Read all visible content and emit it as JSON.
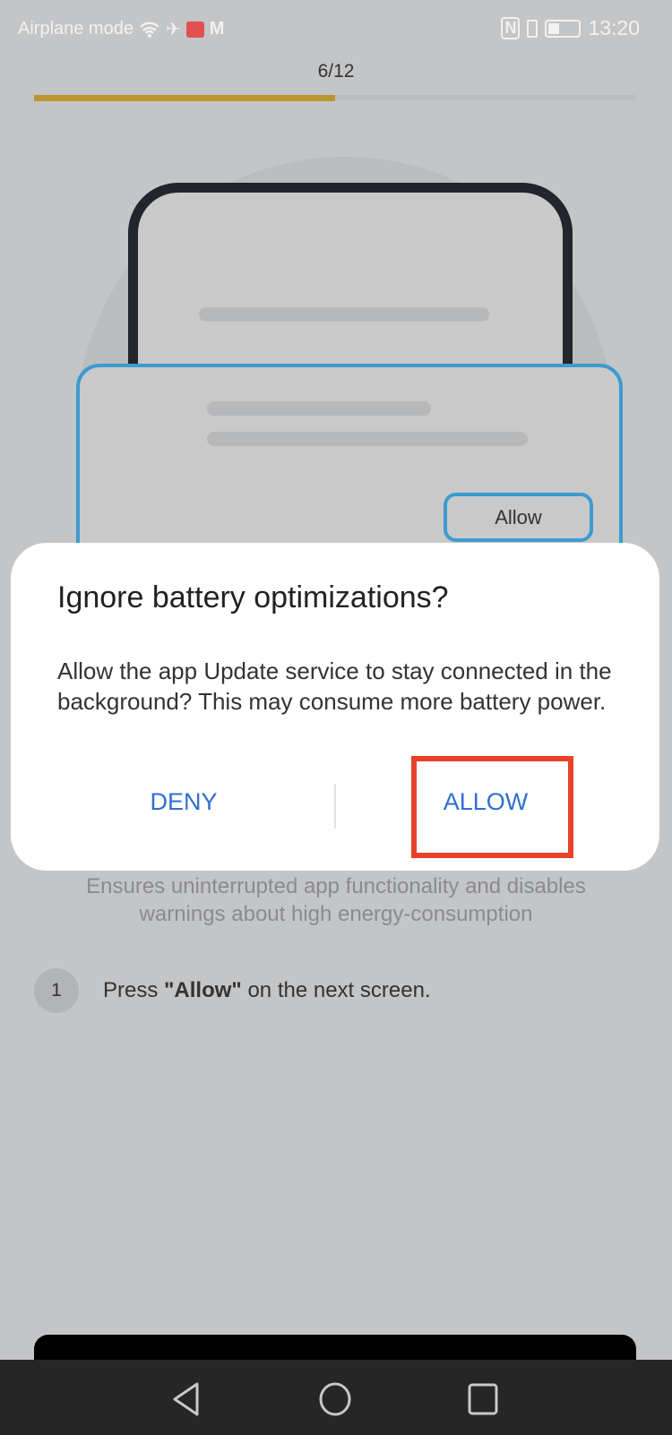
{
  "status_bar": {
    "left_text": "Airplane mode",
    "time": "13:20",
    "icons": [
      "wifi-icon",
      "airplane-icon",
      "app-notification-icon",
      "gmail-icon",
      "nfc-icon",
      "vibrate-icon",
      "battery-icon"
    ]
  },
  "progress": {
    "label": "6/12",
    "current": 6,
    "total": 12,
    "color": "#bb9530"
  },
  "illustration": {
    "button_label": "Allow",
    "accent": "#3c9bd0"
  },
  "dialog": {
    "title": "Ignore battery optimizations?",
    "body": "Allow the app Update service to stay connected in the background? This may consume more battery power.",
    "deny_label": "DENY",
    "allow_label": "ALLOW",
    "button_color": "#2f6fd0",
    "highlight_color": "#e8412a"
  },
  "page": {
    "subtitle": "Ensures uninterrupted app functionality and disables warnings about high energy-consumption",
    "step": {
      "number": "1",
      "prefix": "Press ",
      "bold": "\"Allow\"",
      "suffix": " on the next screen."
    }
  },
  "nav": {
    "icons": [
      "back-icon",
      "home-icon",
      "recents-icon"
    ]
  }
}
